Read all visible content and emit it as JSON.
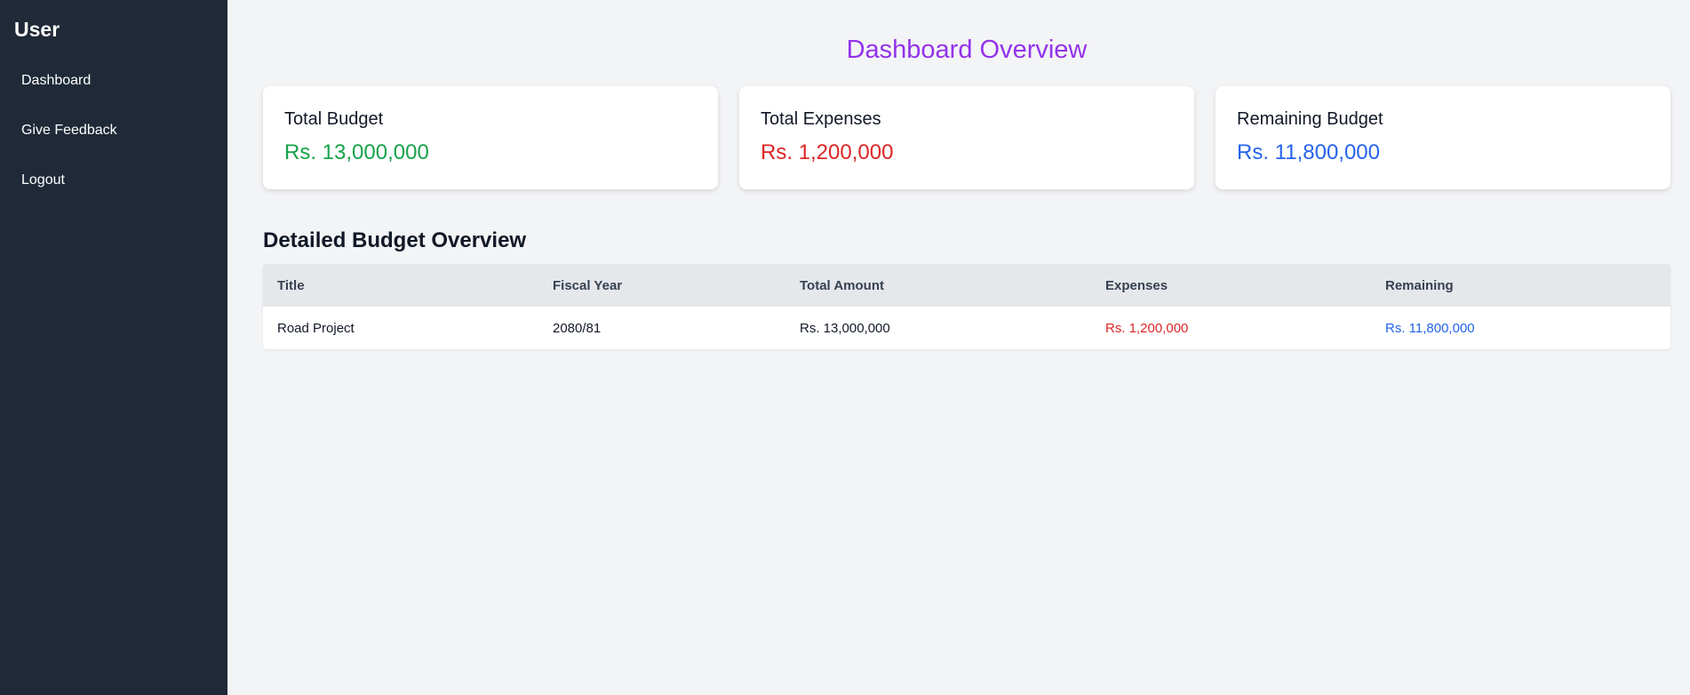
{
  "sidebar": {
    "title": "User",
    "items": [
      {
        "label": "Dashboard"
      },
      {
        "label": "Give Feedback"
      },
      {
        "label": "Logout"
      }
    ]
  },
  "main": {
    "title": "Dashboard Overview",
    "cards": [
      {
        "label": "Total Budget",
        "value": "Rs. 13,000,000",
        "color": "#16a34a"
      },
      {
        "label": "Total Expenses",
        "value": "Rs. 1,200,000",
        "color": "#dc2626"
      },
      {
        "label": "Remaining Budget",
        "value": "Rs. 11,800,000",
        "color": "#2563eb"
      }
    ],
    "section_title": "Detailed Budget Overview",
    "table": {
      "headers": [
        "Title",
        "Fiscal Year",
        "Total Amount",
        "Expenses",
        "Remaining"
      ],
      "rows": [
        [
          "Road Project",
          "2080/81",
          "Rs. 13,000,000",
          "Rs. 1,200,000",
          "Rs. 11,800,000"
        ]
      ]
    }
  },
  "colors": {
    "sidebar_bg": "#1f2937",
    "title_purple": "#9333ea",
    "expense_red": "#dc2626",
    "remaining_blue": "#2563eb",
    "budget_green": "#16a34a"
  }
}
